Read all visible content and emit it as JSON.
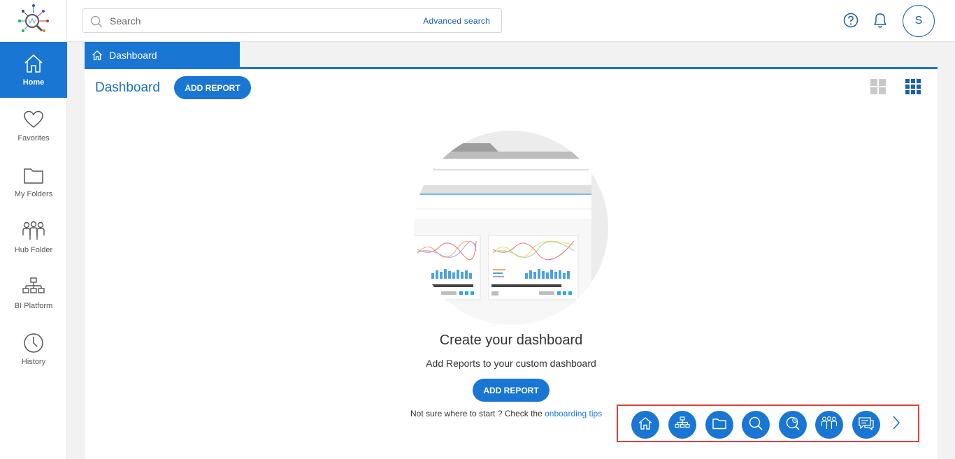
{
  "app": {
    "avatar_letter": "S"
  },
  "search": {
    "placeholder": "Search",
    "value": "",
    "advanced_label": "Advanced search"
  },
  "sidebar": {
    "items": [
      {
        "label": "Home",
        "icon": "home-icon",
        "active": true
      },
      {
        "label": "Favorites",
        "icon": "heart-icon",
        "active": false
      },
      {
        "label": "My Folders",
        "icon": "folder-icon",
        "active": false
      },
      {
        "label": "Hub Folder",
        "icon": "people-icon",
        "active": false
      },
      {
        "label": "BI Platform",
        "icon": "hierarchy-icon",
        "active": false
      },
      {
        "label": "History",
        "icon": "clock-icon",
        "active": false
      }
    ]
  },
  "tab": {
    "label": "Dashboard",
    "icon": "home-icon"
  },
  "main": {
    "title": "Dashboard",
    "add_report_label": "ADD REPORT",
    "empty_title": "Create your dashboard",
    "empty_subtitle": "Add Reports to your custom dashboard",
    "empty_add_label": "ADD REPORT",
    "tips_prefix": "Not sure where to start ? Check the ",
    "tips_link": "onboarding tips"
  },
  "onboarding": {
    "icons": [
      "home-icon",
      "hierarchy-icon",
      "folder-icon",
      "search-icon",
      "search-history-icon",
      "people-icon",
      "chat-icon"
    ]
  },
  "colors": {
    "accent": "#1976d2",
    "highlight_border": "#d9413b",
    "link": "#1c7ad6"
  }
}
